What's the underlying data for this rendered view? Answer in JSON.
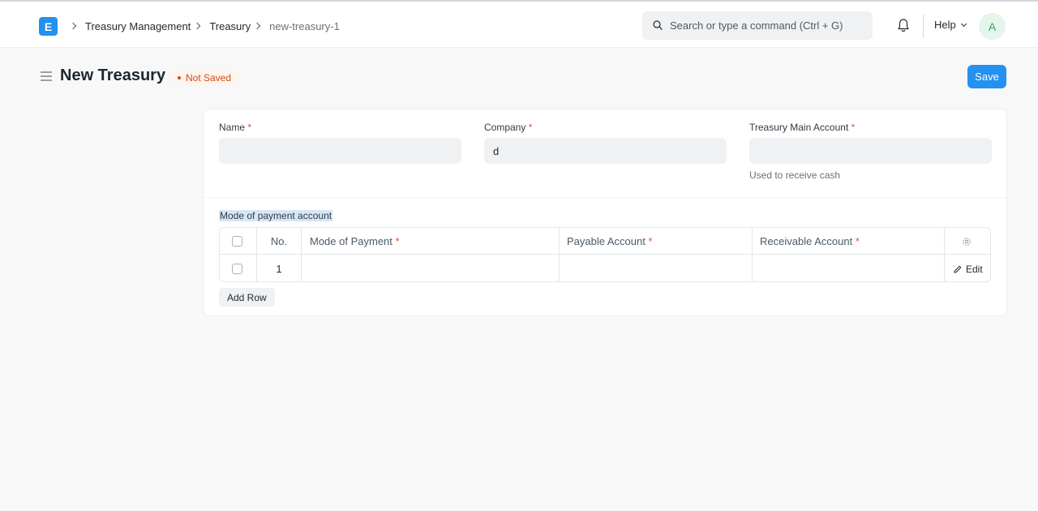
{
  "app": {
    "logo_letter": "E"
  },
  "breadcrumb": {
    "items": [
      "Treasury Management",
      "Treasury",
      "new-treasury-1"
    ]
  },
  "search": {
    "placeholder": "Search or type a command (Ctrl + G)"
  },
  "navbar": {
    "help_label": "Help",
    "avatar_initial": "A"
  },
  "page": {
    "title": "New Treasury",
    "status": "Not Saved",
    "save_label": "Save"
  },
  "form": {
    "fields": [
      {
        "label": "Name",
        "required": "*",
        "value": ""
      },
      {
        "label": "Company",
        "required": "*",
        "value": "d"
      },
      {
        "label": "Treasury Main Account",
        "required": "*",
        "value": "",
        "description": "Used to receive cash"
      }
    ],
    "table_section_label": "Mode of payment account",
    "table": {
      "columns": [
        {
          "label": "No.",
          "required": ""
        },
        {
          "label": "Mode of Payment",
          "required": "*"
        },
        {
          "label": "Payable Account",
          "required": "*"
        },
        {
          "label": "Receivable Account",
          "required": "*"
        }
      ],
      "rows": [
        {
          "no": "1",
          "mode_of_payment": "",
          "payable_account": "",
          "receivable_account": "",
          "edit_label": "Edit"
        }
      ]
    },
    "add_row_label": "Add Row"
  },
  "colors": {
    "primary": "#2490ef",
    "status_not_saved": "#cb4d14",
    "required_marker": "#e24c4c"
  }
}
